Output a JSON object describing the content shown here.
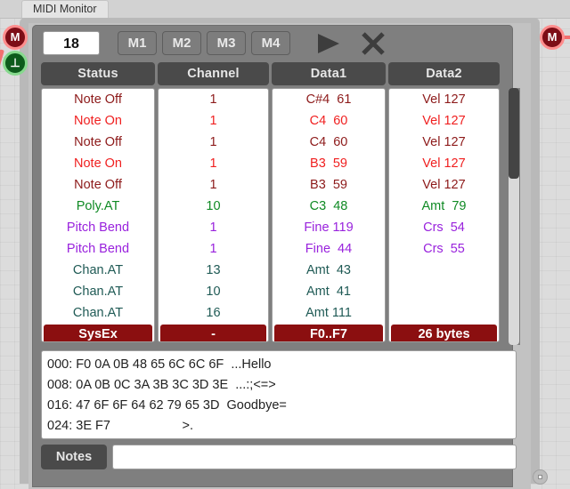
{
  "window": {
    "tab_title": "MIDI Monitor"
  },
  "toolbar": {
    "count_value": "18",
    "memory_buttons": [
      {
        "label": "M1"
      },
      {
        "label": "M2"
      },
      {
        "label": "M3"
      },
      {
        "label": "M4"
      }
    ],
    "play_icon": "play-triangle-icon",
    "clear_icon": "clear-x-icon"
  },
  "table": {
    "headers": [
      "Status",
      "Channel",
      "Data1",
      "Data2"
    ],
    "rows": [
      {
        "status": "Note Off",
        "channel": "1",
        "data1": "C#4  61",
        "data2": "Vel 127",
        "type": "noteoff"
      },
      {
        "status": "Note On",
        "channel": "1",
        "data1": "C4  60",
        "data2": "Vel 127",
        "type": "noteon"
      },
      {
        "status": "Note Off",
        "channel": "1",
        "data1": "C4  60",
        "data2": "Vel 127",
        "type": "noteoff"
      },
      {
        "status": "Note On",
        "channel": "1",
        "data1": "B3  59",
        "data2": "Vel 127",
        "type": "noteon"
      },
      {
        "status": "Note Off",
        "channel": "1",
        "data1": "B3  59",
        "data2": "Vel 127",
        "type": "noteoff"
      },
      {
        "status": "Poly.AT",
        "channel": "10",
        "data1": "C3  48",
        "data2": "Amt  79",
        "type": "polyat"
      },
      {
        "status": "Pitch Bend",
        "channel": "1",
        "data1": "Fine 119",
        "data2": "Crs  54",
        "type": "pitchbend"
      },
      {
        "status": "Pitch Bend",
        "channel": "1",
        "data1": "Fine  44",
        "data2": "Crs  55",
        "type": "pitchbend"
      },
      {
        "status": "Chan.AT",
        "channel": "13",
        "data1": "Amt  43",
        "data2": "",
        "type": "chanat"
      },
      {
        "status": "Chan.AT",
        "channel": "10",
        "data1": "Amt  41",
        "data2": "",
        "type": "chanat"
      },
      {
        "status": "Chan.AT",
        "channel": "16",
        "data1": "Amt 111",
        "data2": "",
        "type": "chanat"
      },
      {
        "status": "SysEx",
        "channel": "-",
        "data1": "F0..F7",
        "data2": "26 bytes",
        "type": "sysex"
      }
    ],
    "colors": {
      "note_off": "#8d1a1a",
      "note_on": "#f01f1f",
      "poly_at": "#0f8a24",
      "pitch_bend": "#9922dd",
      "chan_at": "#1f5a55",
      "sysex_background": "#8b0f10",
      "header_background": "#4a4a4a",
      "panel_background": "#7f7f7f"
    }
  },
  "hexdump": {
    "lines": [
      "000: F0 0A 0B 48 65 6C 6C 6F  ...Hello",
      "008: 0A 0B 0C 3A 3B 3C 3D 3E  ...:;<=>",
      "016: 47 6F 6F 64 62 79 65 3D  Goodbye=",
      "024: 3E F7                    >."
    ]
  },
  "notes": {
    "label": "Notes",
    "value": "",
    "placeholder": ""
  },
  "ports": {
    "midi_in_label": "M",
    "midi_out_label": "⊥",
    "midi_right_label": "M"
  }
}
